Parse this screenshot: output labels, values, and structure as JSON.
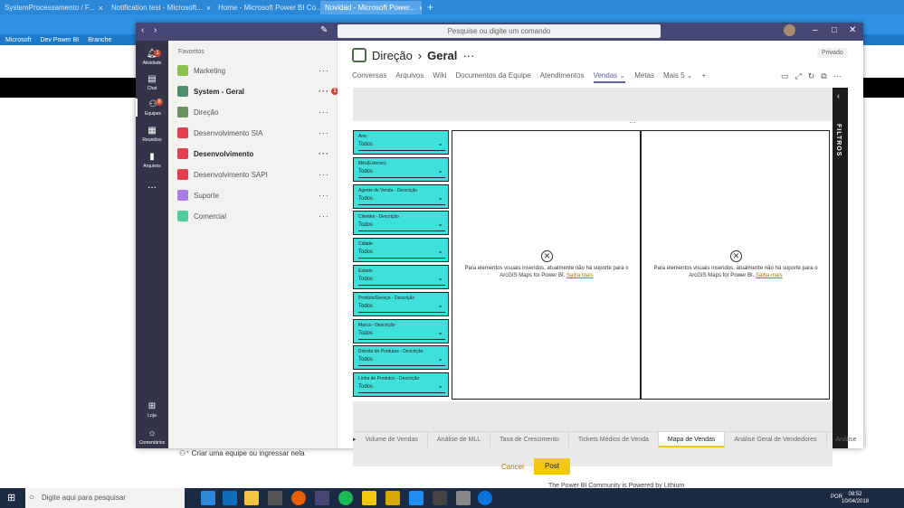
{
  "browser": {
    "tabs": [
      {
        "label": "SystemProcessamento / F..."
      },
      {
        "label": "Notification test - Microsoft..."
      },
      {
        "label": "Home - Microsoft Power BI Co..."
      },
      {
        "label": "Novidad - Microsoft Power..."
      }
    ],
    "bookmarks": [
      "Microsoft",
      "Dev Power BI",
      "Branche"
    ]
  },
  "teams": {
    "search_placeholder": "Pesquise ou digite um comando",
    "rail": [
      {
        "label": "Atividade",
        "badge": "1"
      },
      {
        "label": "Chat"
      },
      {
        "label": "Equipes",
        "badge": "8"
      },
      {
        "label": "Reuniões"
      },
      {
        "label": "Arquivos"
      },
      {
        "label": "..."
      },
      {
        "label": "Loja"
      },
      {
        "label": "Comentários"
      }
    ],
    "favorites_label": "Favoritos",
    "teams": [
      {
        "name": "Marketing",
        "color": "#8bc34a",
        "bold": false
      },
      {
        "name": "System - Geral",
        "color": "#4d8f6e",
        "bold": true,
        "badge": "1"
      },
      {
        "name": "Direção",
        "color": "#6b8f5e",
        "bold": false
      },
      {
        "name": "Desenvolvimento SIA",
        "color": "#e04050",
        "bold": false
      },
      {
        "name": "Desenvolvimento",
        "color": "#e04050",
        "bold": true
      },
      {
        "name": "Desenvolvimento SAPI",
        "color": "#e04050",
        "bold": false
      },
      {
        "name": "Suporte",
        "color": "#a77ce0",
        "bold": false
      },
      {
        "name": "Comercial",
        "color": "#4ecf9a",
        "bold": false
      }
    ],
    "create_team": "Criar uma equipe ou ingressar nela",
    "channel": {
      "team": "Direção",
      "name": "Geral",
      "privacy": "Privado"
    },
    "channel_tabs": [
      "Conversas",
      "Arquivos",
      "Wiki",
      "Documentos da Equipe",
      "Atendimentos",
      "Vendas ⌄",
      "Metas",
      "Mais 5 ⌄",
      "+"
    ],
    "active_tab_index": 5
  },
  "report": {
    "slicers": [
      {
        "label": "Ano",
        "value": "Todos"
      },
      {
        "label": "Mês(Extenso)",
        "value": "Todos"
      },
      {
        "label": "Agente de Venda - Descrição",
        "value": "Todos"
      },
      {
        "label": "Clientes - Descrição",
        "value": "Todos"
      },
      {
        "label": "Cidade",
        "value": "Todos"
      },
      {
        "label": "Estado",
        "value": "Todos"
      },
      {
        "label": "Produto/Serviço - Descrição",
        "value": "Todos"
      },
      {
        "label": "Marca - Descrição",
        "value": "Todos"
      },
      {
        "label": "Divisão de Produtos - Descrição",
        "value": "Todos"
      },
      {
        "label": "Linha de Produtos - Descrição",
        "value": "Todos"
      }
    ],
    "visual_message": "Para elementos visuais inseridos, atualmente não há suporte para o ArcGIS Maps for Power BI.",
    "visual_link": "Saiba mais",
    "filters_label": "FILTROS",
    "page_tabs": [
      "Volume de Vendas",
      "Análise de MLL",
      "Taxa de Crescimento",
      "Tickets Médios de Venda",
      "Mapa de Vendas",
      "Análise Geral de Vendedores",
      "Análise"
    ],
    "active_page_index": 4
  },
  "form": {
    "cancel": "Cancel",
    "post": "Post",
    "footer": "The Power BI Community is Powered by Lithium"
  },
  "taskbar": {
    "search_placeholder": "Digite aqui para pesquisar",
    "lang": "POR",
    "time": "08:52",
    "date": "10/04/2018"
  },
  "colors": {
    "teams_purple": "#464775",
    "slicer_cyan": "#3ee0dc",
    "powerbi_yellow": "#f2c811"
  }
}
